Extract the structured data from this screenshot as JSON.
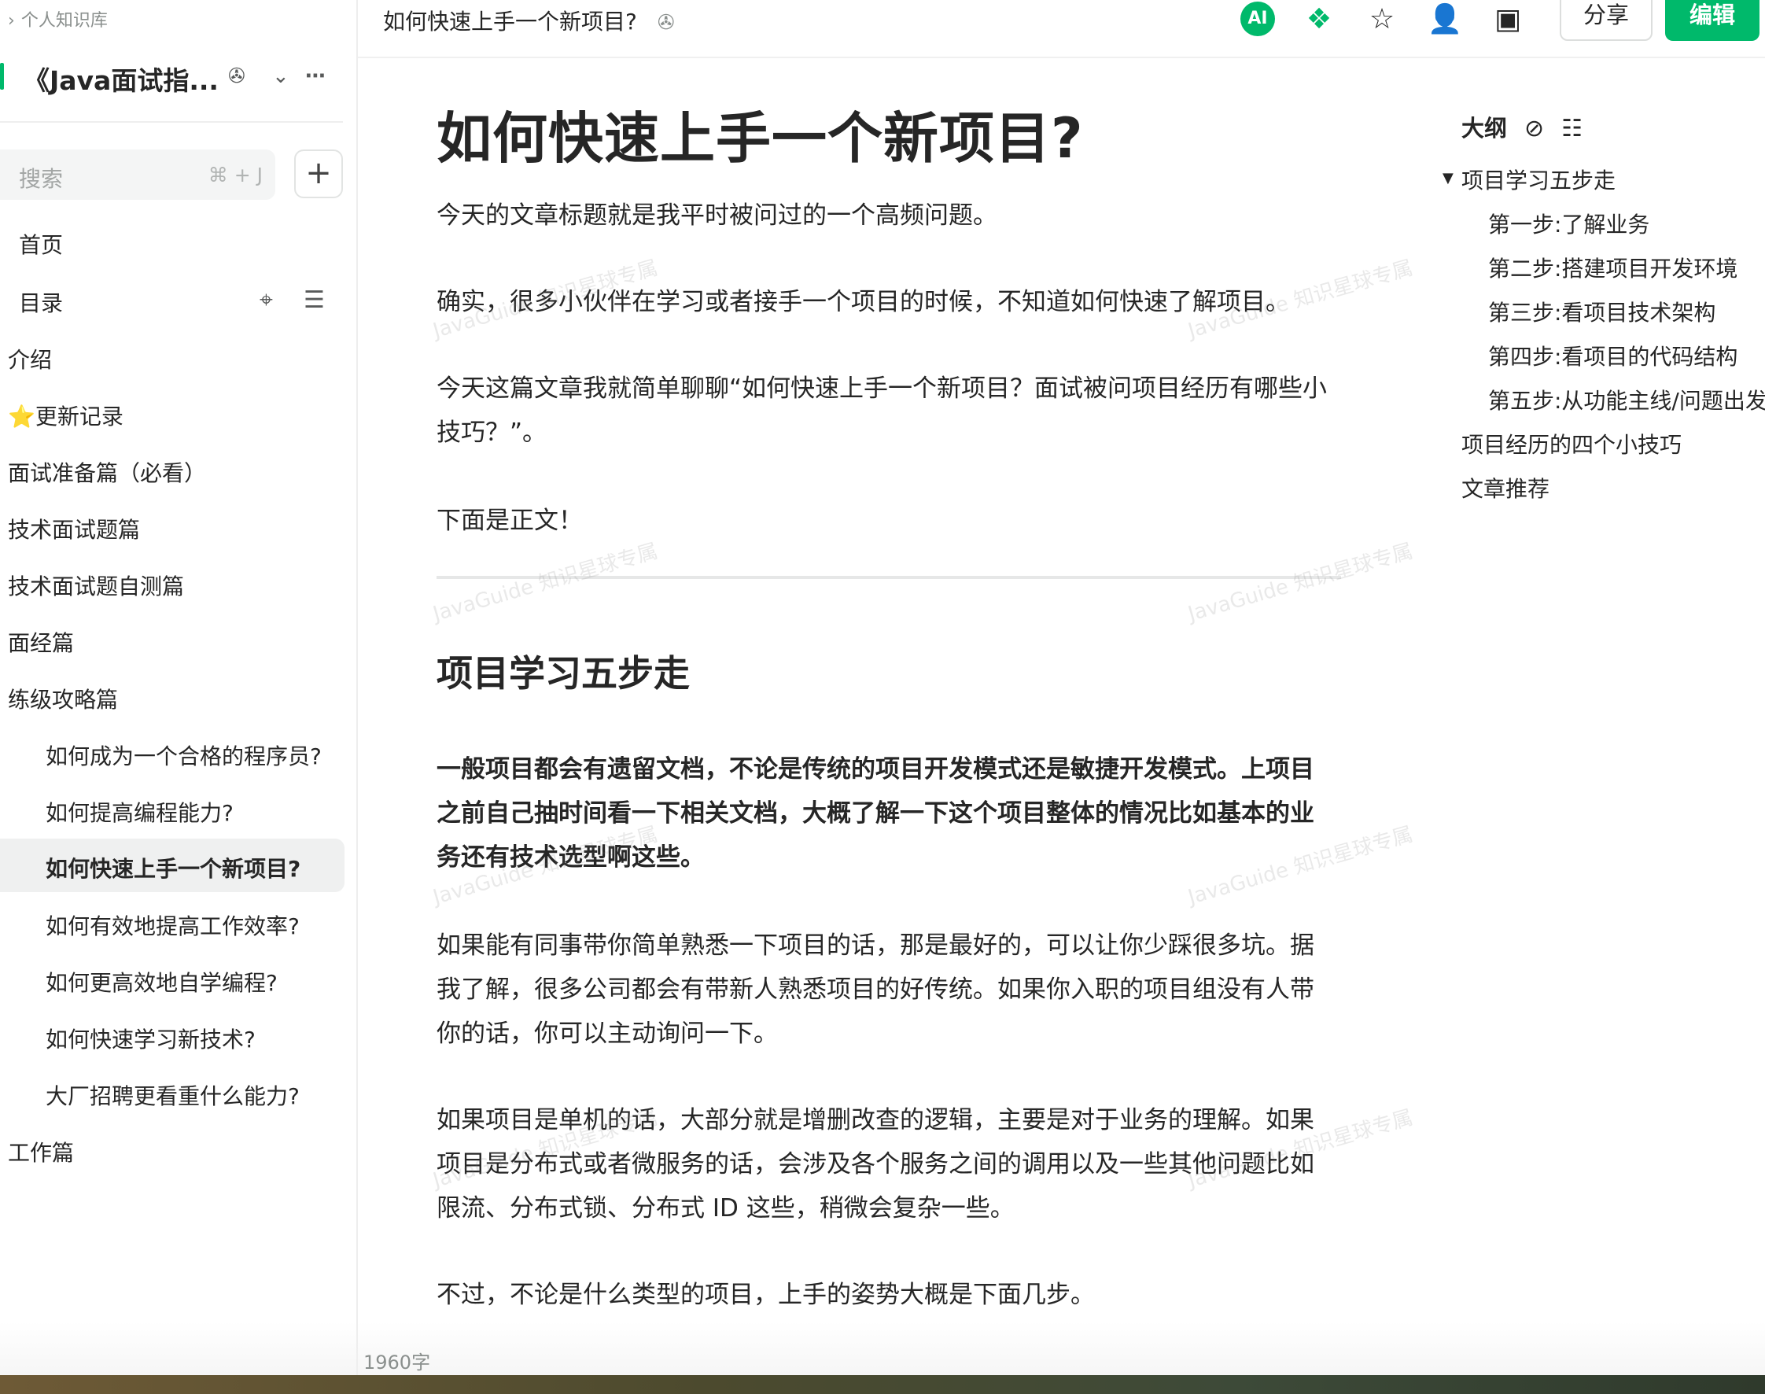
{
  "sidebar": {
    "breadcrumb": "个人知识库",
    "book_title": "《Java面试指...",
    "search": {
      "placeholder": "搜索",
      "shortcut": "⌘ + J"
    },
    "nav": {
      "home": "首页",
      "toc": "目录"
    },
    "items": [
      {
        "label": "介绍"
      },
      {
        "label": "⭐更新记录"
      },
      {
        "label": "面试准备篇（必看）"
      },
      {
        "label": "技术面试题篇"
      },
      {
        "label": "技术面试题自测篇"
      },
      {
        "label": "面经篇"
      },
      {
        "label": "练级攻略篇"
      },
      {
        "label": "如何成为一个合格的程序员?"
      },
      {
        "label": "如何提高编程能力?"
      },
      {
        "label": "如何快速上手一个新项目?"
      },
      {
        "label": "如何有效地提高工作效率?"
      },
      {
        "label": "如何更高效地自学编程?"
      },
      {
        "label": "如何快速学习新技术?"
      },
      {
        "label": "大厂招聘更看重什么能力?"
      },
      {
        "label": "工作篇"
      }
    ]
  },
  "header": {
    "doc_title": "如何快速上手一个新项目?",
    "ai_label": "AI",
    "share_label": "分享",
    "edit_label": "编辑"
  },
  "article": {
    "title": "如何快速上手一个新项目?",
    "p1": "今天的文章标题就是我平时被问过的一个高频问题。",
    "p2": "确实，很多小伙伴在学习或者接手一个项目的时候，不知道如何快速了解项目。",
    "p3": "今天这篇文章我就简单聊聊“如何快速上手一个新项目？面试被问项目经历有哪些小技巧？”。",
    "p4": "下面是正文！",
    "h2": "项目学习五步走",
    "p5": "一般项目都会有遗留文档，不论是传统的项目开发模式还是敏捷开发模式。上项目之前自己抽时间看一下相关文档，大概了解一下这个项目整体的情况比如基本的业务还有技术选型啊这些。",
    "p6": "如果能有同事带你简单熟悉一下项目的话，那是最好的，可以让你少踩很多坑。据我了解，很多公司都会有带新人熟悉项目的好传统。如果你入职的项目组没有人带你的话，你可以主动询问一下。",
    "p7": "如果项目是单机的话，大部分就是增删改查的逻辑，主要是对于业务的理解。如果项目是分布式或者微服务的话，会涉及各个服务之间的调用以及一些其他问题比如限流、分布式锁、分布式 ID 这些，稍微会复杂一些。",
    "p8": "不过，不论是什么类型的项目，上手的姿势大概是下面几步。",
    "watermark": "JavaGuide 知识星球专属"
  },
  "outline": {
    "heading": "大纲",
    "items": [
      {
        "label": "项目学习五步走"
      },
      {
        "label": "第一步:了解业务"
      },
      {
        "label": "第二步:搭建项目开发环境"
      },
      {
        "label": "第三步:看项目技术架构"
      },
      {
        "label": "第四步:看项目的代码结构"
      },
      {
        "label": "第五步:从功能主线/问题出发"
      },
      {
        "label": "项目经历的四个小技巧"
      },
      {
        "label": "文章推荐"
      }
    ]
  },
  "footer": {
    "word_count": "1960字"
  },
  "colors": {
    "accent": "#00b96b",
    "text": "#262626",
    "muted": "#8a8f8d"
  }
}
